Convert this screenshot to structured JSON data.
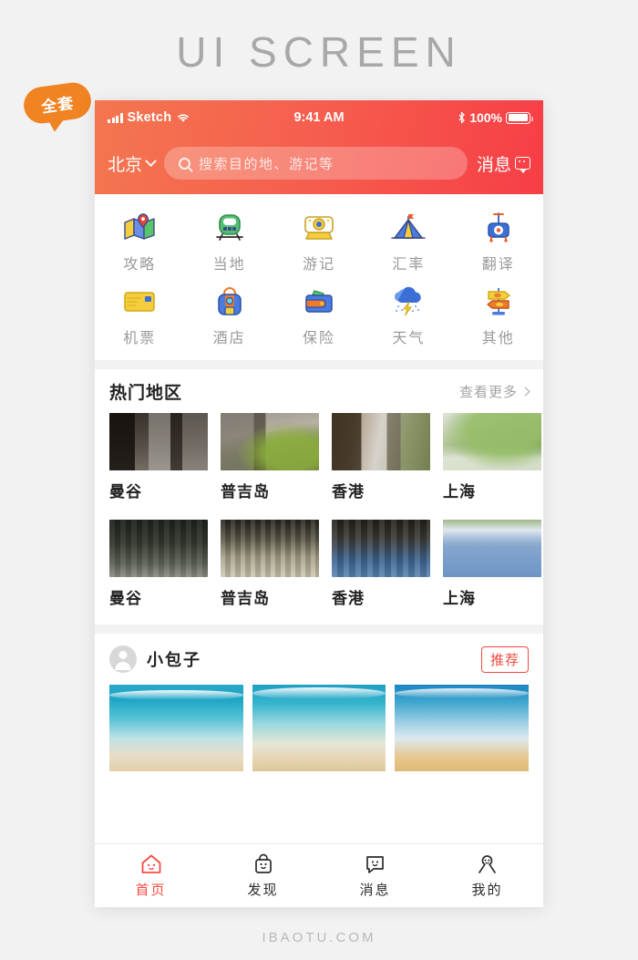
{
  "banner": {
    "title": "UI SCREEN",
    "badge": "全套"
  },
  "statusbar": {
    "carrier": "Sketch",
    "time": "9:41 AM",
    "battery_pct": "100%",
    "signal_icon": "signal-bars-icon",
    "wifi_icon": "wifi-icon",
    "bluetooth_icon": "bluetooth-icon",
    "battery_icon": "battery-icon"
  },
  "header": {
    "city": "北京",
    "city_chevron_icon": "chevron-down-icon",
    "search_placeholder": "搜索目的地、游记等",
    "search_icon": "search-icon",
    "message_label": "消息",
    "message_icon": "message-bubble-icon",
    "gradient_from": "#F4764F",
    "gradient_to": "#F73E46"
  },
  "quick_grid": [
    {
      "label": "攻略",
      "icon": "map-icon"
    },
    {
      "label": "当地",
      "icon": "train-icon"
    },
    {
      "label": "游记",
      "icon": "camera-icon"
    },
    {
      "label": "汇率",
      "icon": "tent-icon"
    },
    {
      "label": "翻译",
      "icon": "translate-device-icon"
    },
    {
      "label": "机票",
      "icon": "ticket-card-icon"
    },
    {
      "label": "酒店",
      "icon": "backpack-icon"
    },
    {
      "label": "保险",
      "icon": "wallet-icon"
    },
    {
      "label": "天气",
      "icon": "storm-cloud-icon"
    },
    {
      "label": "其他",
      "icon": "signpost-icon"
    }
  ],
  "hot_regions": {
    "title": "热门地区",
    "more_label": "查看更多",
    "more_icon": "chevron-right-icon",
    "row1": [
      {
        "name": "曼谷",
        "photo": "ph-a"
      },
      {
        "name": "普吉岛",
        "photo": "ph-b"
      },
      {
        "name": "香港",
        "photo": "ph-c"
      },
      {
        "name": "上海",
        "photo": "ph-d"
      }
    ],
    "row2": [
      {
        "name": "曼谷",
        "photo": "ph-e"
      },
      {
        "name": "普吉岛",
        "photo": "ph-f"
      },
      {
        "name": "香港",
        "photo": "ph-g"
      },
      {
        "name": "上海",
        "photo": "ph-h"
      }
    ]
  },
  "user_post": {
    "avatar_icon": "avatar-icon",
    "username": "小包子",
    "badge": "推荐",
    "badge_color": "#F0483F",
    "photos": [
      "ph-sea1",
      "ph-sea2",
      "ph-sea3"
    ]
  },
  "tabbar": [
    {
      "label": "首页",
      "icon": "home-icon",
      "active": true
    },
    {
      "label": "发现",
      "icon": "bag-icon",
      "active": false
    },
    {
      "label": "消息",
      "icon": "chat-icon",
      "active": false
    },
    {
      "label": "我的",
      "icon": "person-icon",
      "active": false
    }
  ],
  "footer": {
    "site": "IBAOTU.COM"
  }
}
